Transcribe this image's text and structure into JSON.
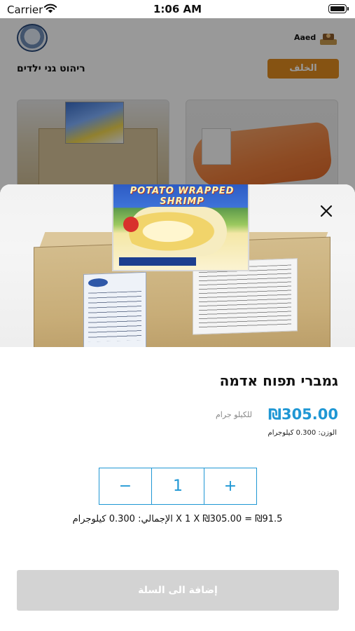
{
  "status_bar": {
    "carrier": "Carrier",
    "time": "1:06 AM"
  },
  "background_page": {
    "user_name": "Aaed",
    "store_title": "ריהוט גני ילדים",
    "back_label": "الخلف",
    "accent_color": "#e08a1e"
  },
  "product": {
    "name": "גמברי תפוח אדמה",
    "price": "₪305.00",
    "unit": "للكيلو جرام",
    "weight": "الوزن: 0.300 كيلوجرام",
    "package_title": "POTATO WRAPPED SHRIMP",
    "price_color": "#1f97d4"
  },
  "quantity": {
    "minus": "−",
    "value": "1",
    "plus": "+"
  },
  "total": {
    "text": "الإجمالي: 0.300 كيلوجرام X 1 X ₪305.00 = ₪91.5"
  },
  "actions": {
    "add_to_cart": "إضافة الى السلة"
  },
  "icons": {
    "close": "close-icon",
    "wifi": "wifi-icon",
    "battery": "battery-icon"
  }
}
